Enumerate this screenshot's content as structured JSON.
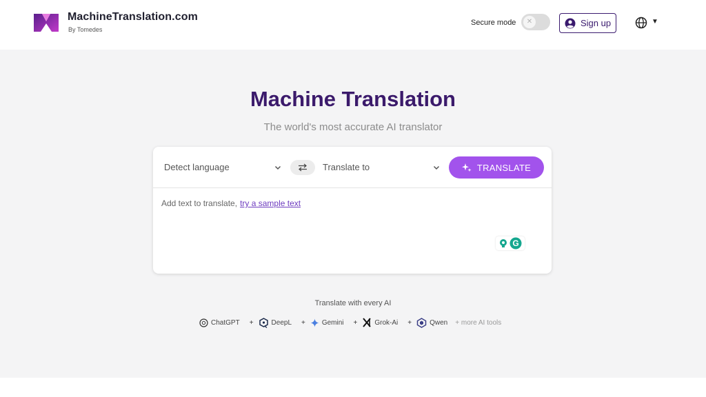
{
  "header": {
    "brand_name": "MachineTranslation.com",
    "brand_sub": "By Tomedes",
    "secure_mode_label": "Secure mode",
    "secure_mode_on": false,
    "signup_label": "Sign up",
    "language_icon": "globe-icon"
  },
  "main": {
    "title": "Machine Translation",
    "subtitle": "The world's most accurate AI translator"
  },
  "translator": {
    "source_language": "Detect language",
    "target_language": "Translate to",
    "translate_label": "TRANSLATE",
    "input_placeholder": "Add text to translate,",
    "sample_link": "try a sample text"
  },
  "ai_tools": {
    "heading": "Translate with every AI",
    "items": [
      {
        "label": "ChatGPT",
        "icon": "chatgpt-icon"
      },
      {
        "label": "DeepL",
        "icon": "deepl-icon"
      },
      {
        "label": "Gemini",
        "icon": "gemini-icon"
      },
      {
        "label": "Grok-Ai",
        "icon": "grok-icon"
      },
      {
        "label": "Qwen",
        "icon": "qwen-icon"
      }
    ],
    "plus": "+",
    "more_label": "+ more AI tools"
  },
  "colors": {
    "brand_purple": "#3b1a6b",
    "button_purple": "#a253ec",
    "background": "#f4f4f5"
  }
}
